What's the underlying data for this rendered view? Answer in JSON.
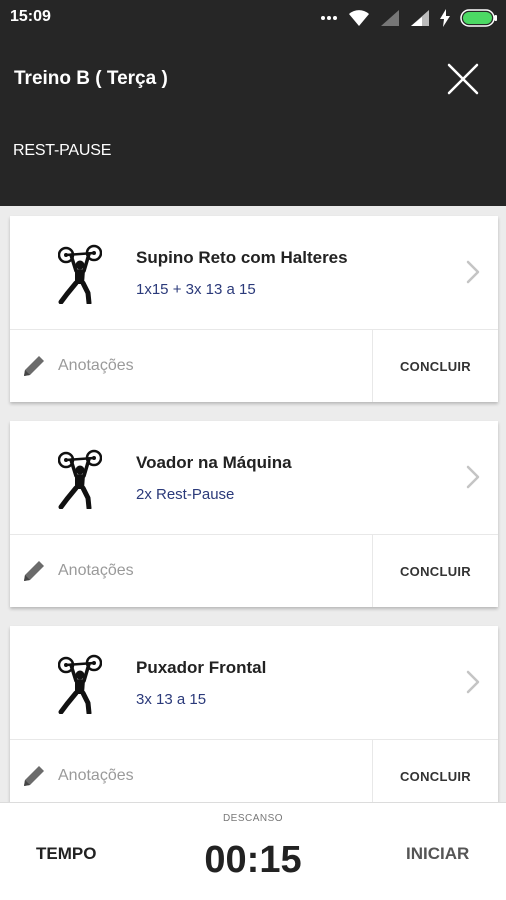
{
  "status_bar": {
    "time": "15:09",
    "icons": [
      "dots-icon",
      "wifi-icon",
      "signal-icon",
      "signal-icon",
      "charging-icon",
      "battery-icon"
    ],
    "battery_color": "#4cd964"
  },
  "header": {
    "title": "Treino B ( Terça )",
    "subtitle": "REST-PAUSE",
    "background": "#262626"
  },
  "exercises": [
    {
      "name": "Supino Reto com Halteres",
      "sets": "1x15 + 3x 13 a 15",
      "notes_placeholder": "Anotações",
      "action": "CONCLUIR"
    },
    {
      "name": "Voador na Máquina",
      "sets": "2x Rest-Pause",
      "notes_placeholder": "Anotações",
      "action": "CONCLUIR"
    },
    {
      "name": "Puxador Frontal",
      "sets": "3x 13 a 15",
      "notes_placeholder": "Anotações",
      "action": "CONCLUIR"
    }
  ],
  "bottom_bar": {
    "tempo_label": "TEMPO",
    "descanso_label": "DESCANSO",
    "timer": "00:15",
    "iniciar_label": "INICIAR"
  }
}
